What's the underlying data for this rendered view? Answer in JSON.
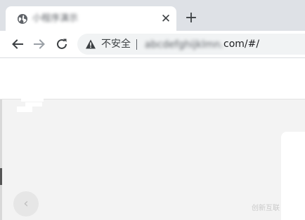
{
  "browser": {
    "tab": {
      "title": "小程序演示",
      "close_glyph": "✕",
      "icon": "globe-icon"
    },
    "new_tab_glyph": "+",
    "toolbar": {
      "back_icon": "arrow-left-icon",
      "forward_icon": "arrow-right-icon",
      "reload_icon": "reload-icon"
    },
    "address_bar": {
      "security_icon": "warning-triangle-icon",
      "security_label": "不安全",
      "url_blurred_part": "abcdefghijklmn.",
      "url_visible_part": "com/#/"
    }
  },
  "page": {
    "prev_button_glyph": "‹",
    "watermark_text": "创新互联"
  },
  "colors": {
    "tabstrip": "#dee1e6",
    "toolbar": "#ffffff",
    "omnibox": "#f1f3f4",
    "page_body": "#f3f3f3"
  }
}
